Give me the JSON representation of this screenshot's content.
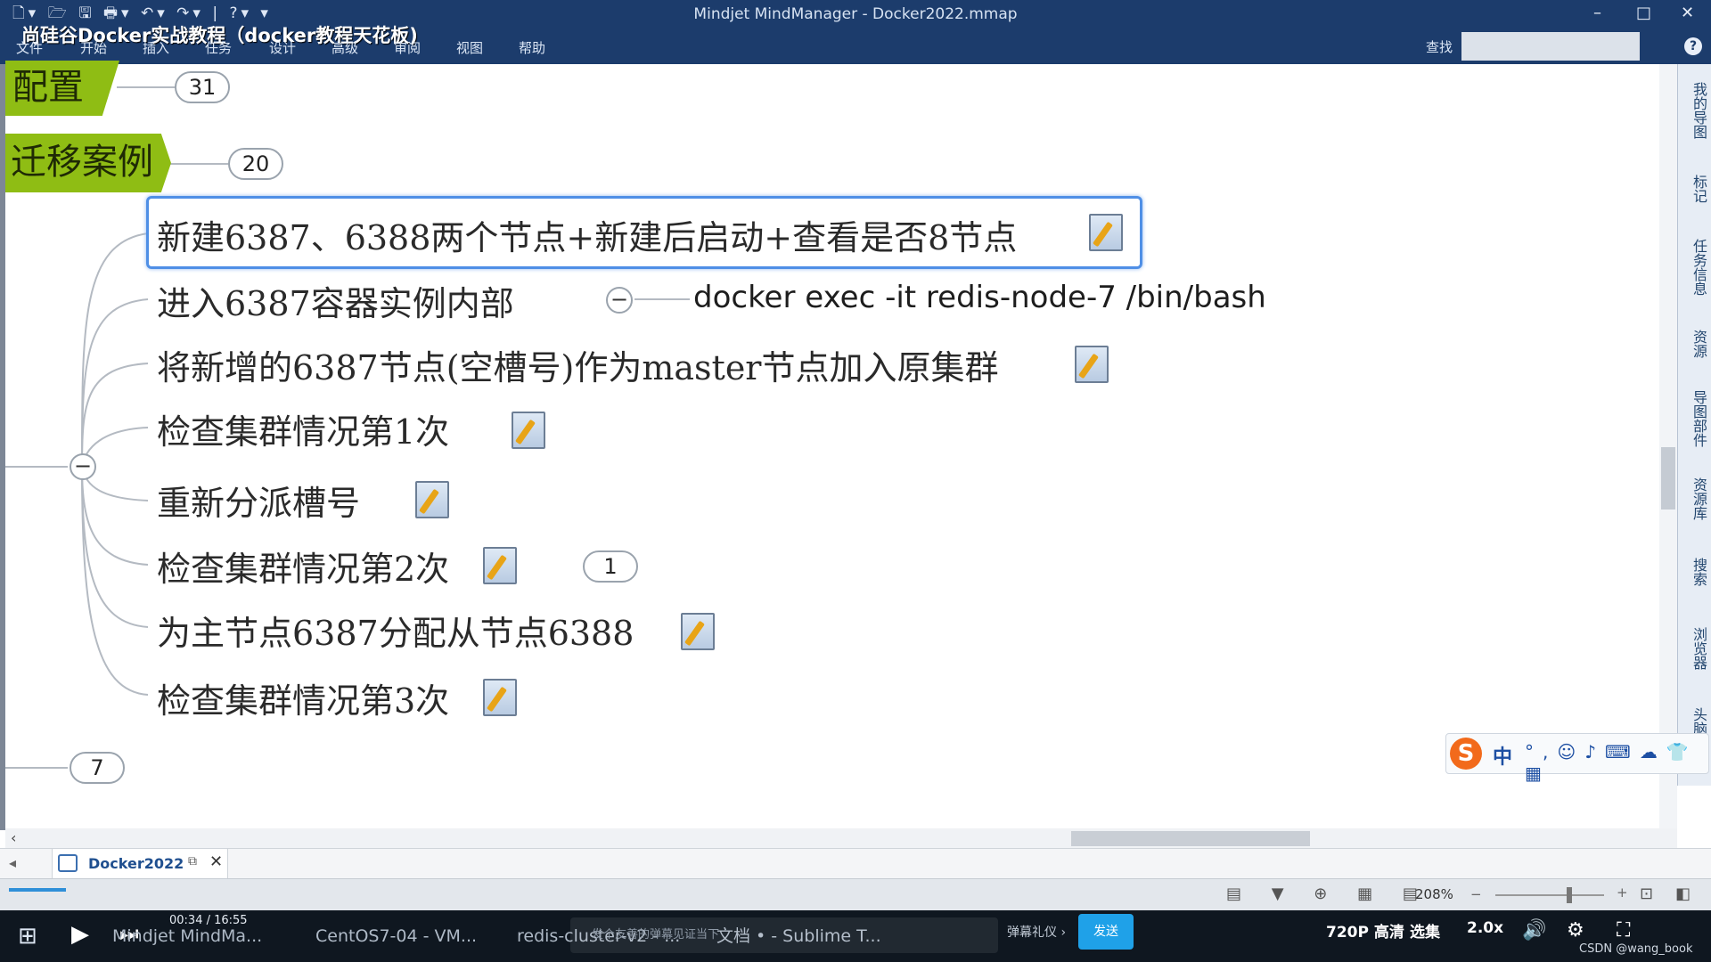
{
  "titlebar": {
    "window_title": "Mindjet MindManager - Docker2022.mmap",
    "overlay_title": "尚硅谷Docker实战教程（docker教程天花板)",
    "menus": [
      "文件",
      "开始",
      "插入",
      "任务",
      "设计",
      "高级",
      "审阅",
      "视图",
      "帮助"
    ],
    "search_label": "查找",
    "controls": {
      "minimize": "–",
      "maximize": "□",
      "close": "✕"
    }
  },
  "map": {
    "upper_topics": [
      {
        "label": "配置",
        "count": "31"
      },
      {
        "label": "迁移案例",
        "count": "20"
      }
    ],
    "subtopics": [
      {
        "label": "新建6387、6388两个节点+新建后启动+查看是否8节点",
        "has_note": true,
        "selected": true
      },
      {
        "label": "进入6387容器实例内部",
        "has_note": false,
        "child": "docker exec -it redis-node-7 /bin/bash"
      },
      {
        "label": "将新增的6387节点(空槽号)作为master节点加入原集群",
        "has_note": true
      },
      {
        "label": "检查集群情况第1次",
        "has_note": true
      },
      {
        "label": "重新分派槽号",
        "has_note": true
      },
      {
        "label": "检查集群情况第2次",
        "has_note": true,
        "count": "1"
      },
      {
        "label": "为主节点6387分配从节点6388",
        "has_note": true
      },
      {
        "label": "检查集群情况第3次",
        "has_note": true
      }
    ],
    "bottom_count": "7"
  },
  "sidebar": {
    "items": [
      "我的导图",
      "标记",
      "任务信息",
      "资源",
      "导图部件",
      "资源库",
      "搜索",
      "浏览器",
      "头脑"
    ]
  },
  "ime": {
    "logo": "S",
    "mode": "中"
  },
  "tabs": {
    "active_tab": "Docker2022"
  },
  "status": {
    "zoom": "208%"
  },
  "player": {
    "time": "00:34 / 16:55",
    "danmu_placeholder": "发个友善的弹幕见证当下",
    "danmu_etiquette": "弹幕礼仪 ›",
    "send_label": "发送",
    "quality": "720P 高清",
    "episodes": "选集",
    "speed": "2.0x"
  },
  "taskbar": {
    "tasks": [
      "Mindjet MindMa...",
      "CentOS7-04 - VM...",
      "redis-cluster-v2 - ...",
      "文档 • - Sublime T..."
    ],
    "watermark": "CSDN @wang_book"
  }
}
